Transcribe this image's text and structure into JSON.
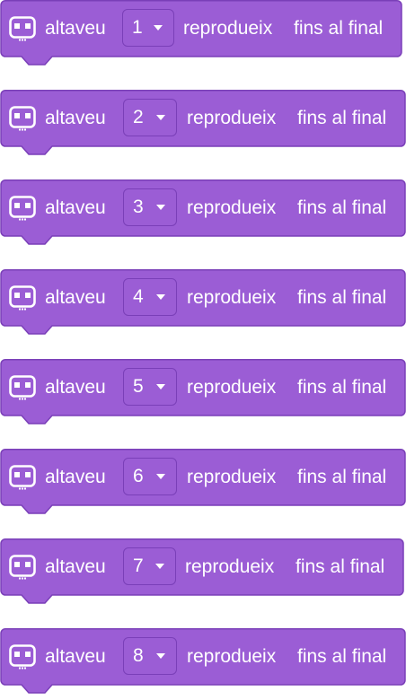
{
  "colors": {
    "block_fill": "#9b5dd5",
    "block_border": "#7a3fb8",
    "text": "#ffffff"
  },
  "blocks": [
    {
      "label": "altaveu",
      "value": "1",
      "action": "reprodueix",
      "mode": "fins al final",
      "icon": "speaker-icon"
    },
    {
      "label": "altaveu",
      "value": "2",
      "action": "reprodueix",
      "mode": "fins al final",
      "icon": "speaker-icon"
    },
    {
      "label": "altaveu",
      "value": "3",
      "action": "reprodueix",
      "mode": "fins al final",
      "icon": "speaker-icon"
    },
    {
      "label": "altaveu",
      "value": "4",
      "action": "reprodueix",
      "mode": "fins al final",
      "icon": "speaker-icon"
    },
    {
      "label": "altaveu",
      "value": "5",
      "action": "reprodueix",
      "mode": "fins al final",
      "icon": "speaker-icon"
    },
    {
      "label": "altaveu",
      "value": "6",
      "action": "reprodueix",
      "mode": "fins al final",
      "icon": "speaker-icon"
    },
    {
      "label": "altaveu",
      "value": "7",
      "action": "reprodueix",
      "mode": "fins al final",
      "icon": "speaker-icon"
    },
    {
      "label": "altaveu",
      "value": "8",
      "action": "reprodueix",
      "mode": "fins al final",
      "icon": "speaker-icon"
    }
  ]
}
